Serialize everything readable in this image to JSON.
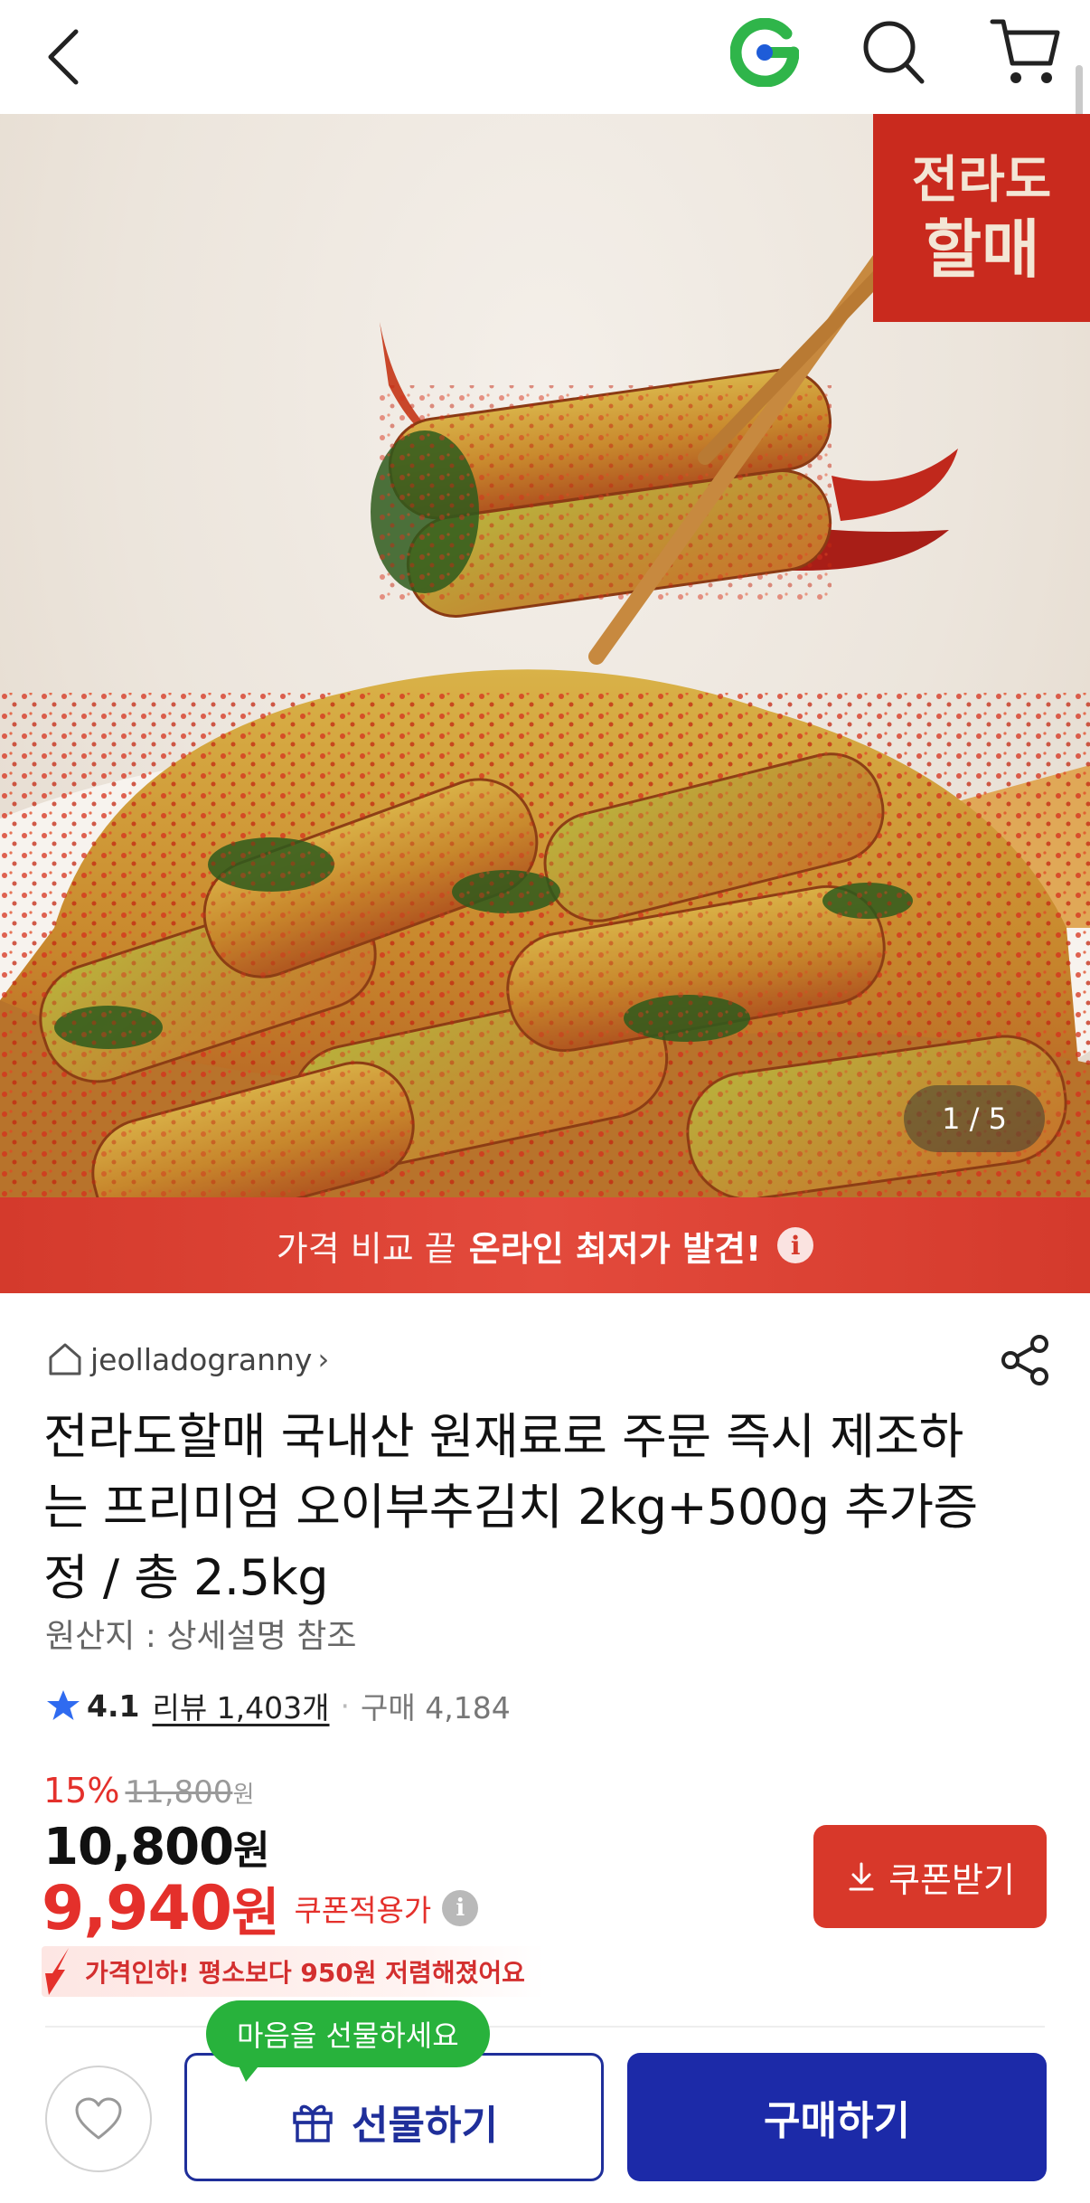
{
  "header": {
    "back_icon": "chevron-left-icon",
    "brand_icon": "g-logo-icon",
    "search_icon": "search-icon",
    "cart_icon": "cart-icon"
  },
  "hero": {
    "badge_line1": "전라도",
    "badge_line2": "할매",
    "counter": "1 / 5"
  },
  "promo": {
    "light_text": "가격 비교 끝",
    "bold_text": "온라인 최저가 발견!",
    "info_glyph": "i"
  },
  "seller": {
    "name": "jeolladogranny",
    "chevron": "›"
  },
  "product": {
    "title": "전라도할매 국내산 원재료로 주문 즉시 제조하는 프리미엄 오이부추김치 2kg+500g 추가증정 / 총 2.5kg",
    "origin": "원산지 : 상세설명 참조",
    "rating": "4.1",
    "reviews": "리뷰 1,403개",
    "purchases": "구매 4,184",
    "separator": "·"
  },
  "pricing": {
    "discount_percent": "15%",
    "original_price": "11,800",
    "original_unit": "원",
    "sale_price": "10,800",
    "sale_unit": "원",
    "coupon_price": "9,940",
    "coupon_unit": "원",
    "coupon_label": "쿠폰적용가",
    "coupon_button": "쿠폰받기",
    "price_drop_text": "가격인하! 평소보다 950원 저렴해졌어요"
  },
  "bottom_bar": {
    "tooltip": "마음을 선물하세요",
    "gift_button": "선물하기",
    "buy_button": "구매하기"
  },
  "colors": {
    "accent_red": "#d8382a",
    "primary_blue": "#1c2aa8",
    "tooltip_green": "#28b23c"
  }
}
